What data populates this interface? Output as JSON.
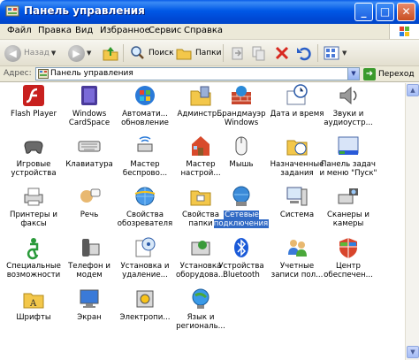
{
  "window": {
    "title": "Панель управления"
  },
  "menu": [
    "Файл",
    "Правка",
    "Вид",
    "Избранное",
    "Сервис",
    "Справка"
  ],
  "toolbar": {
    "back": "Назад",
    "search": "Поиск",
    "folders": "Папки"
  },
  "address": {
    "label": "Адрес:",
    "value": "Панель управления",
    "go": "Переход"
  },
  "items": [
    {
      "label": "Flash Player",
      "icon": "flash-player-icon"
    },
    {
      "label": "Windows\nCardSpace",
      "icon": "cardspace-icon"
    },
    {
      "label": "Автомати...\nобновление",
      "icon": "automatic-updates-icon"
    },
    {
      "label": "Админстр...",
      "icon": "administration-icon"
    },
    {
      "label": "Брандмауэр\nWindows",
      "icon": "firewall-icon"
    },
    {
      "label": "Дата и время",
      "icon": "date-time-icon"
    },
    {
      "label": "Звуки и\nаудиоустр...",
      "icon": "sounds-icon"
    },
    {
      "label": "Игровые\nустройства",
      "icon": "game-controllers-icon"
    },
    {
      "label": "Клавиатура",
      "icon": "keyboard-icon"
    },
    {
      "label": "Мастер\nбеспрово...",
      "icon": "wireless-wizard-icon"
    },
    {
      "label": "Мастер\nнастрой...",
      "icon": "setup-wizard-icon"
    },
    {
      "label": "Мышь",
      "icon": "mouse-icon"
    },
    {
      "label": "Назначенные\nзадания",
      "icon": "scheduled-tasks-icon"
    },
    {
      "label": "Панель задач\nи меню \"Пуск\"",
      "icon": "taskbar-icon"
    },
    {
      "label": "Принтеры и\nфаксы",
      "icon": "printers-icon"
    },
    {
      "label": "Речь",
      "icon": "speech-icon"
    },
    {
      "label": "Свойства\nобозревателя",
      "icon": "internet-options-icon"
    },
    {
      "label": "Свойства\nпапки",
      "icon": "folder-options-icon"
    },
    {
      "label": "Сетевые\nподключения",
      "icon": "network-connections-icon",
      "selected": true
    },
    {
      "label": "Система",
      "icon": "system-icon"
    },
    {
      "label": "Сканеры и\nкамеры",
      "icon": "scanners-icon"
    },
    {
      "label": "Специальные\nвозможности",
      "icon": "accessibility-icon"
    },
    {
      "label": "Телефон и\nмодем",
      "icon": "phone-modem-icon"
    },
    {
      "label": "Установка и\nудаление...",
      "icon": "add-remove-programs-icon"
    },
    {
      "label": "Установка\nоборудова...",
      "icon": "add-hardware-icon"
    },
    {
      "label": "Устройства\nBluetooth",
      "icon": "bluetooth-icon"
    },
    {
      "label": "Учетные\nзаписи пол...",
      "icon": "user-accounts-icon"
    },
    {
      "label": "Центр\nобеспечен...",
      "icon": "security-center-icon"
    },
    {
      "label": "Шрифты",
      "icon": "fonts-icon"
    },
    {
      "label": "Экран",
      "icon": "display-icon"
    },
    {
      "label": "Электропи...",
      "icon": "power-options-icon"
    },
    {
      "label": "Язык и\nрегиональ...",
      "icon": "regional-options-icon"
    }
  ]
}
